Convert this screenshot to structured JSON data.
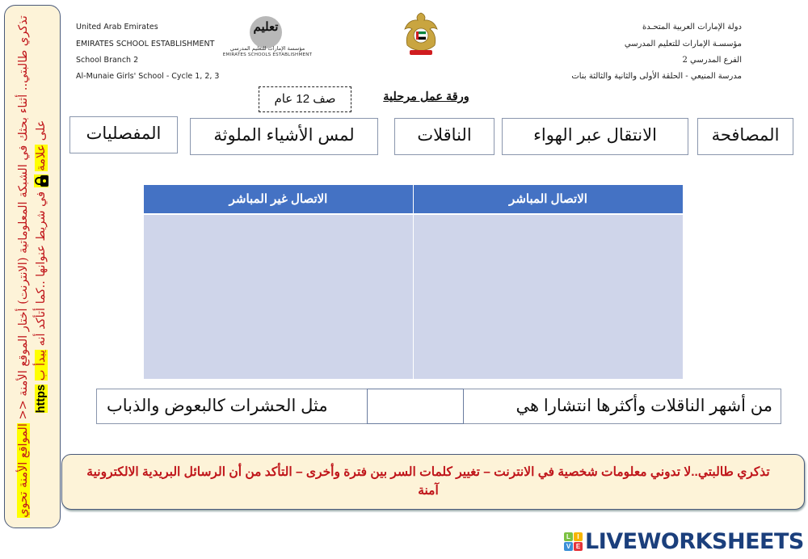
{
  "side_note": {
    "part1": "تذكري طالبتي.. أثناء بحثك في الشبكة المعلوماتية (الانترنت) أختار الموقع الأمنة <<",
    "part2": "المواقع الأمنة تحوي",
    "part3": "على",
    "part4": "علامة",
    "part5": "في شريط عنوانها ..كما أتأكد أنه",
    "part6": "يبدأ ب",
    "https": "https",
    "lock_icon": "lock-icon",
    "text_color": "#c0161b",
    "highlight_color": "#ffff00"
  },
  "header": {
    "english_lines": [
      "United Arab Emirates",
      "EMIRATES SCHOOL ESTABLISHMENT",
      "School Branch 2",
      "Al-Munaie Girls' School - Cycle 1, 2, 3"
    ],
    "arabic_lines": [
      "دولة الإمارات العربية المتحـدة",
      "مؤسسـة الإمارات للتعليم المدرسي",
      "الفرع المدرسي 2",
      "مدرسة المنيعي - الحلقة الأولى والثانية والثالثة بنات"
    ],
    "logo": {
      "circle_text": "تعليم",
      "arabic": "مؤسسة الإمارات للتعليم المدرسي",
      "english": "EMIRATES SCHOOLS ESTABLISHMENT"
    },
    "emblem_icon": "uae-emblem-icon"
  },
  "title": {
    "grade": "صف 12 عام",
    "worksheet": "ورقة عمل مرحلية"
  },
  "chips": [
    {
      "label": "المصافحة"
    },
    {
      "label": "الانتقال عبر الهواء"
    },
    {
      "label": "الناقلات"
    },
    {
      "label": "لمس الأشياء الملوثة"
    },
    {
      "label": "المفصليات"
    }
  ],
  "table": {
    "headers": [
      "الاتصال المباشر",
      "الاتصال غير المباشر"
    ],
    "header_color": "#4472c4",
    "cell_color": "#cfd5ea"
  },
  "sentence": {
    "part1": "من أشهر الناقلات وأكثرها انتشارا هي",
    "blank_value": "",
    "part2": "مثل الحشرات كالبعوض والذباب"
  },
  "bottom_note": {
    "text": "تذكري طالبتي..لا تدوني معلومات شخصية في الانترنت – تغيير كلمات السر بين فترة وأخرى – التأكد من أن الرسائل البريدية الالكترونية آمنة"
  },
  "brand": {
    "text": "LIVEWORKSHEETS",
    "tiles": [
      "L",
      "I",
      "V",
      "E"
    ],
    "color": "#1b3f7c"
  }
}
